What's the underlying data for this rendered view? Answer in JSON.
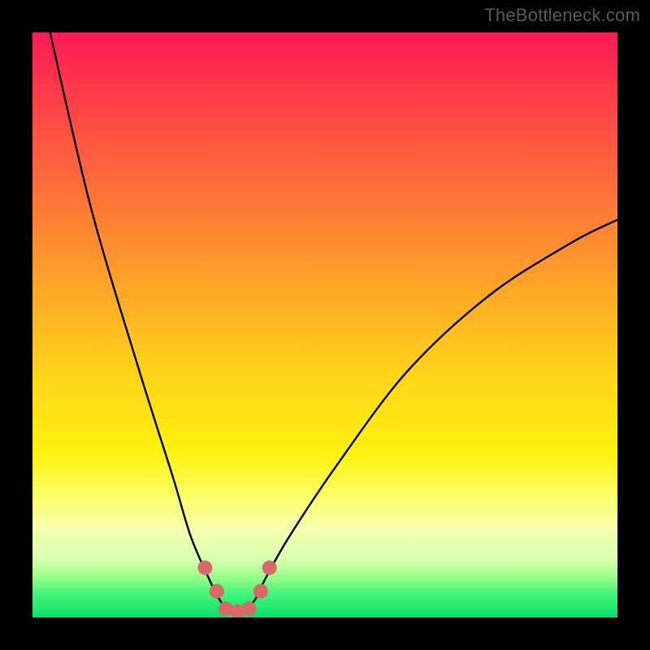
{
  "watermark": "TheBottleneck.com",
  "chart_data": {
    "type": "line",
    "title": "",
    "xlabel": "",
    "ylabel": "",
    "xlim": [
      0,
      100
    ],
    "ylim": [
      0,
      100
    ],
    "grid": false,
    "legend": false,
    "gradient_stops": [
      {
        "pos": 0,
        "color": "#ff1a55"
      },
      {
        "pos": 10,
        "color": "#ff3a4a"
      },
      {
        "pos": 25,
        "color": "#ff6a3a"
      },
      {
        "pos": 42,
        "color": "#ffa029"
      },
      {
        "pos": 58,
        "color": "#ffd31a"
      },
      {
        "pos": 72,
        "color": "#fff210"
      },
      {
        "pos": 80,
        "color": "#fcff70"
      },
      {
        "pos": 85,
        "color": "#f6ffb0"
      },
      {
        "pos": 90,
        "color": "#d9ffb0"
      },
      {
        "pos": 93,
        "color": "#9cff8a"
      },
      {
        "pos": 96,
        "color": "#42f47a"
      },
      {
        "pos": 100,
        "color": "#09e06a"
      }
    ],
    "series": [
      {
        "name": "bottleneck-curve",
        "x": [
          3,
          10,
          18,
          24,
          27,
          30,
          32,
          34,
          36,
          38,
          40,
          44,
          52,
          64,
          78,
          92,
          100
        ],
        "values": [
          100,
          70,
          43,
          24,
          14,
          7,
          3,
          1,
          1,
          3,
          7,
          14,
          26,
          42,
          55,
          64,
          68
        ]
      }
    ],
    "markers": {
      "name": "highlight-points",
      "color": "#d86a6a",
      "x": [
        29.5,
        31.5,
        33,
        35,
        37,
        39,
        40.5
      ],
      "values": [
        8.5,
        4.5,
        1.5,
        1,
        1.5,
        4.5,
        8.5
      ]
    }
  }
}
